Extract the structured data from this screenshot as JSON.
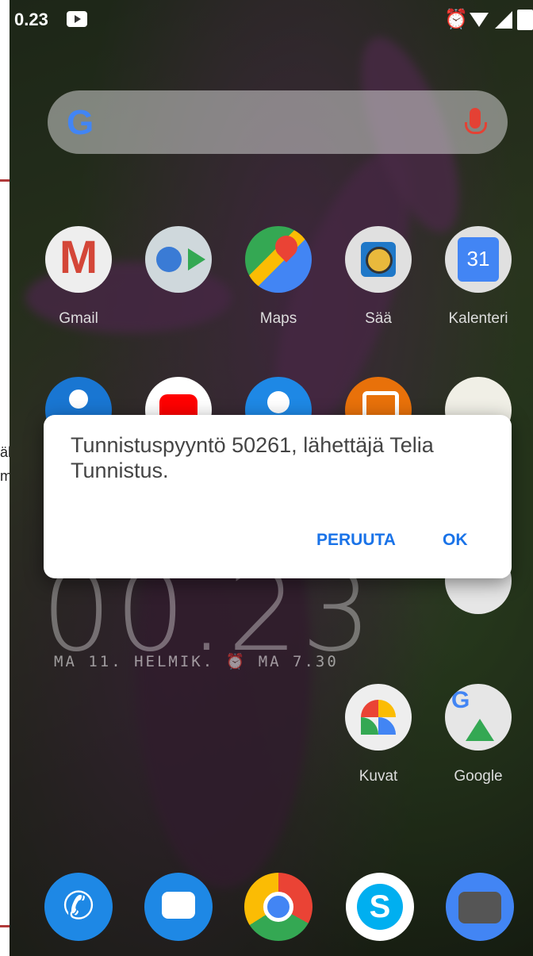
{
  "left_page": {
    "text_1": "äl",
    "text_2": "m"
  },
  "status_bar": {
    "time": "0.23",
    "icons": [
      "screen-record-icon",
      "alarm-icon",
      "wifi-icon",
      "signal-icon",
      "battery-icon"
    ]
  },
  "search": {
    "logo": "G",
    "mic": "mic-icon"
  },
  "apps": {
    "row1": [
      {
        "label": "Gmail",
        "icon": "gmail-icon"
      },
      {
        "label": "",
        "icon": "settings-play-folder-icon"
      },
      {
        "label": "Maps",
        "icon": "maps-icon"
      },
      {
        "label": "Sää",
        "icon": "weather-icon"
      },
      {
        "label": "Kalenteri",
        "icon": "calendar-icon"
      }
    ],
    "row3": [
      {
        "label": "Kuvat",
        "icon": "photos-icon"
      },
      {
        "label": "Google",
        "icon": "google-folder-icon"
      }
    ]
  },
  "clock": {
    "time": "00.23",
    "date": "MA 11. HELMIK.",
    "alarm": "MA 7.30"
  },
  "dialog": {
    "message": "Tunnistuspyyntö 50261, lähettäjä Telia Tunnistus.",
    "cancel_label": "PERUUTA",
    "ok_label": "OK"
  },
  "dock": [
    "phone-icon",
    "messages-icon",
    "chrome-icon",
    "skype-icon",
    "camera-icon"
  ],
  "colors": {
    "dialog_button": "#1a73e8",
    "dialog_text": "#444444"
  }
}
